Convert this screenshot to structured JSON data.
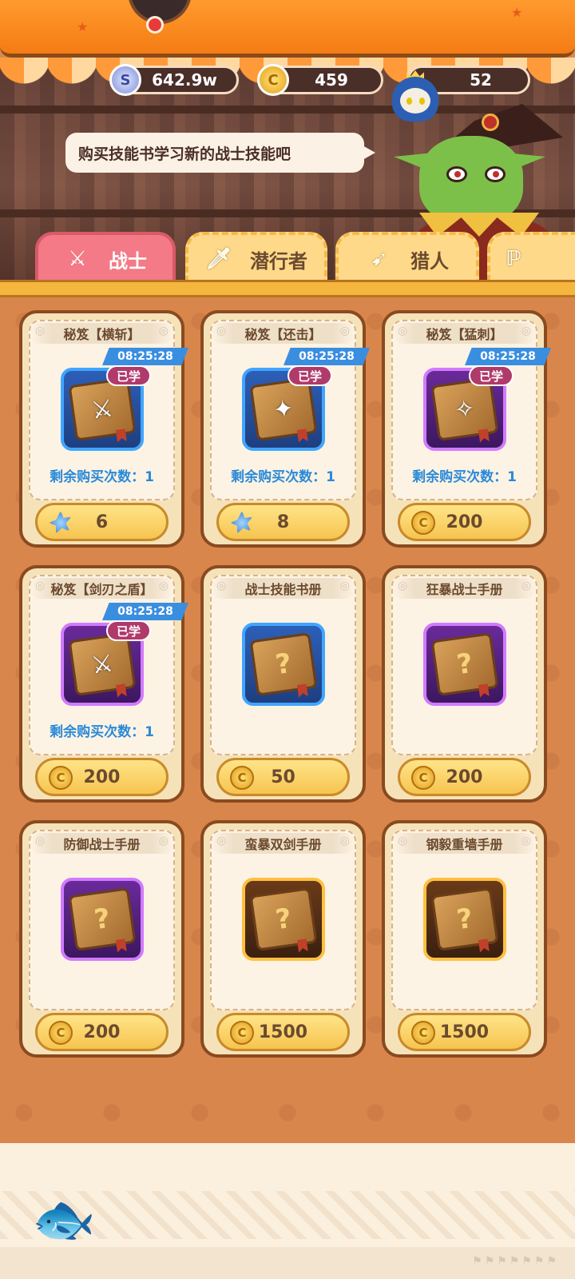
{
  "currencies": [
    {
      "icon": "silver-coin-icon",
      "value": "642.9w"
    },
    {
      "icon": "gold-coin-icon",
      "value": "459"
    },
    {
      "icon": "avatar-icon",
      "value": "52"
    }
  ],
  "speech": "购买技能书学习新的战士技能吧",
  "tabs": [
    {
      "label": "战士",
      "icon": "sword-icon",
      "active": true
    },
    {
      "label": "潜行者",
      "icon": "dagger-icon",
      "active": false
    },
    {
      "label": "猎人",
      "icon": "bow-icon",
      "active": false
    },
    {
      "label": "",
      "icon": "staff-icon",
      "active": false
    }
  ],
  "cards": [
    {
      "title": "秘笈【横斩】",
      "timer": "08:25:28",
      "learned": "已学",
      "frame": "blue",
      "remain": "剩余购买次数：1",
      "price_icon": "gem-icon",
      "price": "6"
    },
    {
      "title": "秘笈【还击】",
      "timer": "08:25:28",
      "learned": "已学",
      "frame": "blue",
      "remain": "剩余购买次数：1",
      "price_icon": "gem-icon",
      "price": "8"
    },
    {
      "title": "秘笈【猛刺】",
      "timer": "08:25:28",
      "learned": "已学",
      "frame": "purple",
      "remain": "剩余购买次数：1",
      "price_icon": "gold-coin-icon",
      "price": "200"
    },
    {
      "title": "秘笈【剑刃之盾】",
      "timer": "08:25:28",
      "learned": "已学",
      "frame": "purple",
      "remain": "剩余购买次数：1",
      "price_icon": "gold-coin-icon",
      "price": "200"
    },
    {
      "title": "战士技能书册",
      "frame": "blue",
      "price_icon": "gold-coin-icon",
      "price": "50"
    },
    {
      "title": "狂暴战士手册",
      "frame": "purple",
      "price_icon": "gold-coin-icon",
      "price": "200"
    },
    {
      "title": "防御战士手册",
      "frame": "purple",
      "price_icon": "gold-coin-icon",
      "price": "200"
    },
    {
      "title": "蛮暴双剑手册",
      "frame": "orange",
      "price_icon": "gold-coin-icon",
      "price": "1500"
    },
    {
      "title": "钢毅重墙手册",
      "frame": "orange",
      "price_icon": "gold-coin-icon",
      "price": "1500"
    }
  ],
  "colors": {
    "active_tab": "#f37a86",
    "inactive_tab": "#ffd98a",
    "timer": "#3a8ee0",
    "learned_badge": "#b03a6a",
    "remain_text": "#2a8ad8"
  }
}
